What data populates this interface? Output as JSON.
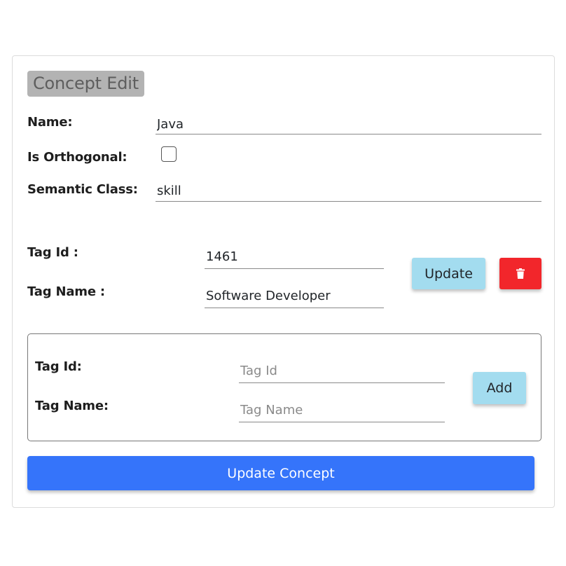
{
  "title": "Concept Edit",
  "form": {
    "name_label": "Name:",
    "name_value": "Java",
    "orthogonal_label": "Is Orthogonal:",
    "orthogonal_checked": false,
    "semantic_label": "Semantic Class:",
    "semantic_value": "skill"
  },
  "tag": {
    "id_label": "Tag Id :",
    "id_value": "1461",
    "name_label": "Tag Name :",
    "name_value": "Software Developer",
    "update_button": "Update",
    "delete_icon": "trash-icon",
    "delete_color": "#f2262b"
  },
  "new_tag": {
    "id_label": "Tag Id:",
    "id_placeholder": "Tag Id",
    "name_label": "Tag Name:",
    "name_placeholder": "Tag Name",
    "add_button": "Add"
  },
  "update_concept_button": "Update Concept",
  "colors": {
    "primary": "#3574fa",
    "info": "#a3dcef",
    "danger": "#f2262b",
    "badge_bg": "#b3b3b3"
  }
}
